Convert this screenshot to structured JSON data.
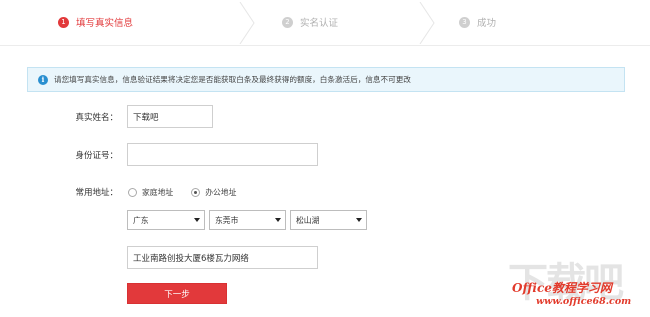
{
  "steps": [
    {
      "num": "1",
      "label": "填写真实信息",
      "state": "active"
    },
    {
      "num": "2",
      "label": "实名认证",
      "state": "inactive"
    },
    {
      "num": "3",
      "label": "成功",
      "state": "inactive"
    }
  ],
  "notice": {
    "icon": "info-icon",
    "text": "请您填写真实信息，信息验证结果将决定您是否能获取白条及最终获得的额度，白条激活后，信息不可更改"
  },
  "form": {
    "name_label": "真实姓名：",
    "name_value": "下载吧",
    "id_label": "身份证号：",
    "id_value": "",
    "address_label": "常用地址：",
    "radio_home": "家庭地址",
    "radio_office": "办公地址",
    "selected_radio": "办公地址",
    "province": "广东",
    "city": "东莞市",
    "district": "松山湖",
    "detail_address": "工业南路创投大厦6楼瓦力网络",
    "next_button": "下一步"
  },
  "watermark": {
    "big": "下载吧",
    "brand_a": "Office",
    "brand_b": "教程学习网",
    "url": "www.office68.com"
  },
  "colors": {
    "accent": "#e2393b",
    "notice_bg": "#eaf6fc",
    "info_blue": "#2a8fd0"
  }
}
